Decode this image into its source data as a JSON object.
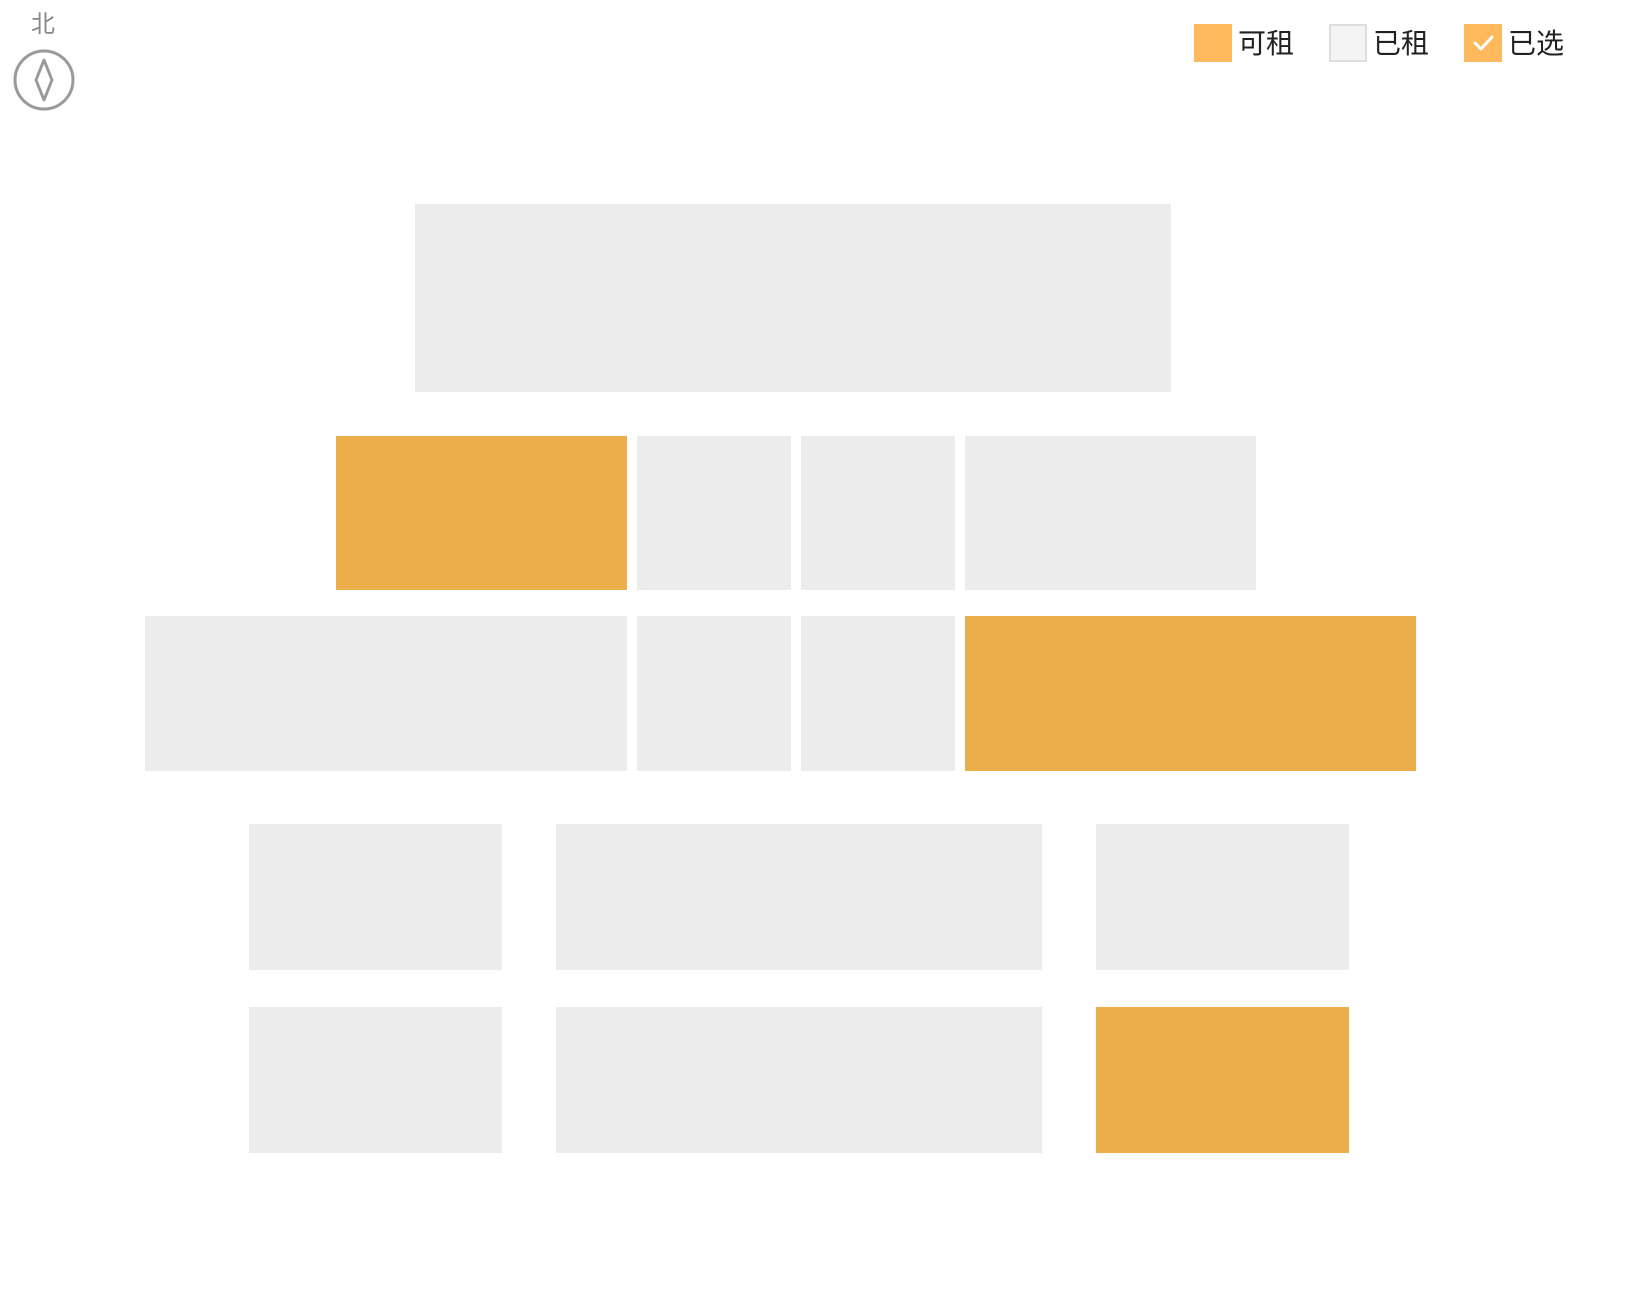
{
  "compass": {
    "label": "北",
    "icon": "compass-icon"
  },
  "legend": {
    "items": [
      {
        "key": "available",
        "label": "可租",
        "color": "#ffb85c",
        "icon": "swatch"
      },
      {
        "key": "rented",
        "label": "已租",
        "color": "#f4f4f4",
        "border": "#dddddd",
        "icon": "swatch"
      },
      {
        "key": "selected",
        "label": "已选",
        "color": "#ffb85c",
        "icon": "check-icon"
      }
    ]
  },
  "colors": {
    "available": "#ebae4a",
    "rented": "#ececec"
  },
  "units": [
    {
      "status": "rented"
    },
    {
      "status": "available"
    },
    {
      "status": "rented"
    },
    {
      "status": "rented"
    },
    {
      "status": "rented"
    },
    {
      "status": "rented"
    },
    {
      "status": "rented"
    },
    {
      "status": "rented"
    },
    {
      "status": "available"
    },
    {
      "status": "rented"
    },
    {
      "status": "rented"
    },
    {
      "status": "rented"
    },
    {
      "status": "rented"
    },
    {
      "status": "rented"
    },
    {
      "status": "available"
    }
  ]
}
